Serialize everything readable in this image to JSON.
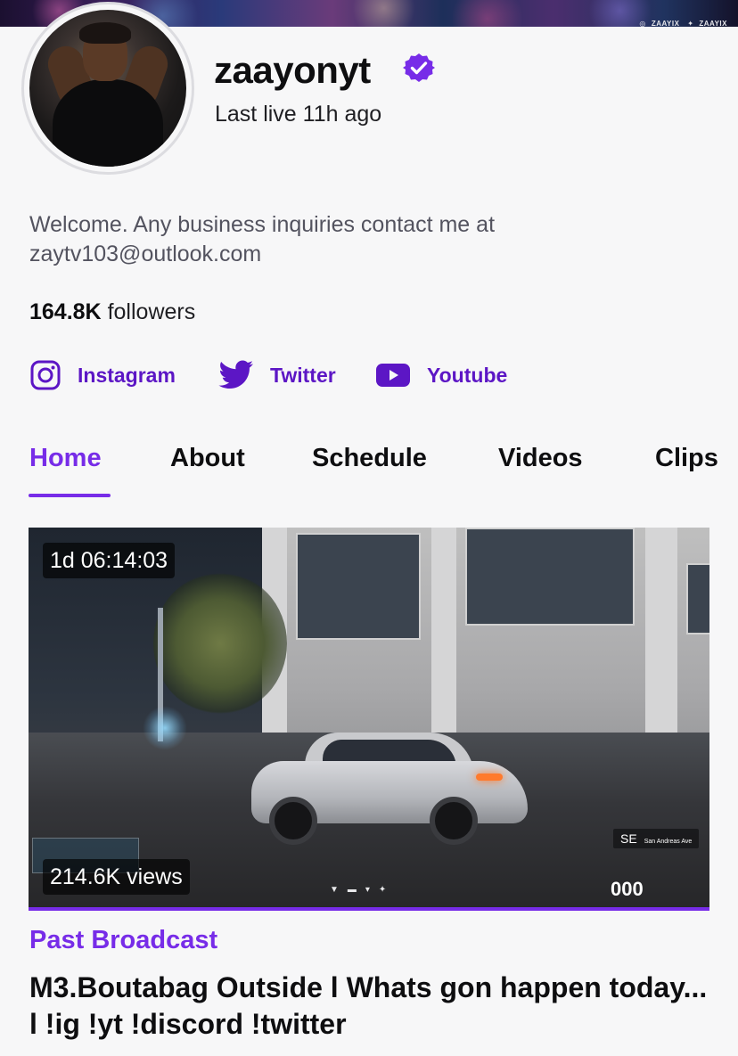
{
  "banner": {
    "handles": [
      "ZAAYIX",
      "ZAAYIX"
    ],
    "icons": [
      "instagram-icon",
      "twitter-icon"
    ]
  },
  "profile": {
    "username": "zaayonyt",
    "verified": true,
    "last_live": "Last live 11h ago",
    "bio": "Welcome. Any business inquiries contact me at zaytv103@outlook.com",
    "followers_count": "164.8K",
    "followers_label": "followers"
  },
  "socials": [
    {
      "label": "Instagram",
      "icon": "instagram-icon"
    },
    {
      "label": "Twitter",
      "icon": "twitter-icon"
    },
    {
      "label": "Youtube",
      "icon": "youtube-icon"
    }
  ],
  "tabs": [
    {
      "label": "Home",
      "active": true
    },
    {
      "label": "About",
      "active": false
    },
    {
      "label": "Schedule",
      "active": false
    },
    {
      "label": "Videos",
      "active": false
    },
    {
      "label": "Clips",
      "active": false
    }
  ],
  "video": {
    "duration": "1d 06:14:03",
    "views": "214.6K views",
    "category": "Past Broadcast",
    "title": "M3.Boutabag Outside l Whats gon happen today... l !ig !yt !discord !twitter",
    "hud": {
      "compass": "SE",
      "street": "San Andreas Ave",
      "speed": "000"
    }
  },
  "colors": {
    "accent": "#772ce8",
    "link": "#5c16c5",
    "background": "#f7f7f8",
    "text": "#0e0e10",
    "muted": "#53535f"
  }
}
